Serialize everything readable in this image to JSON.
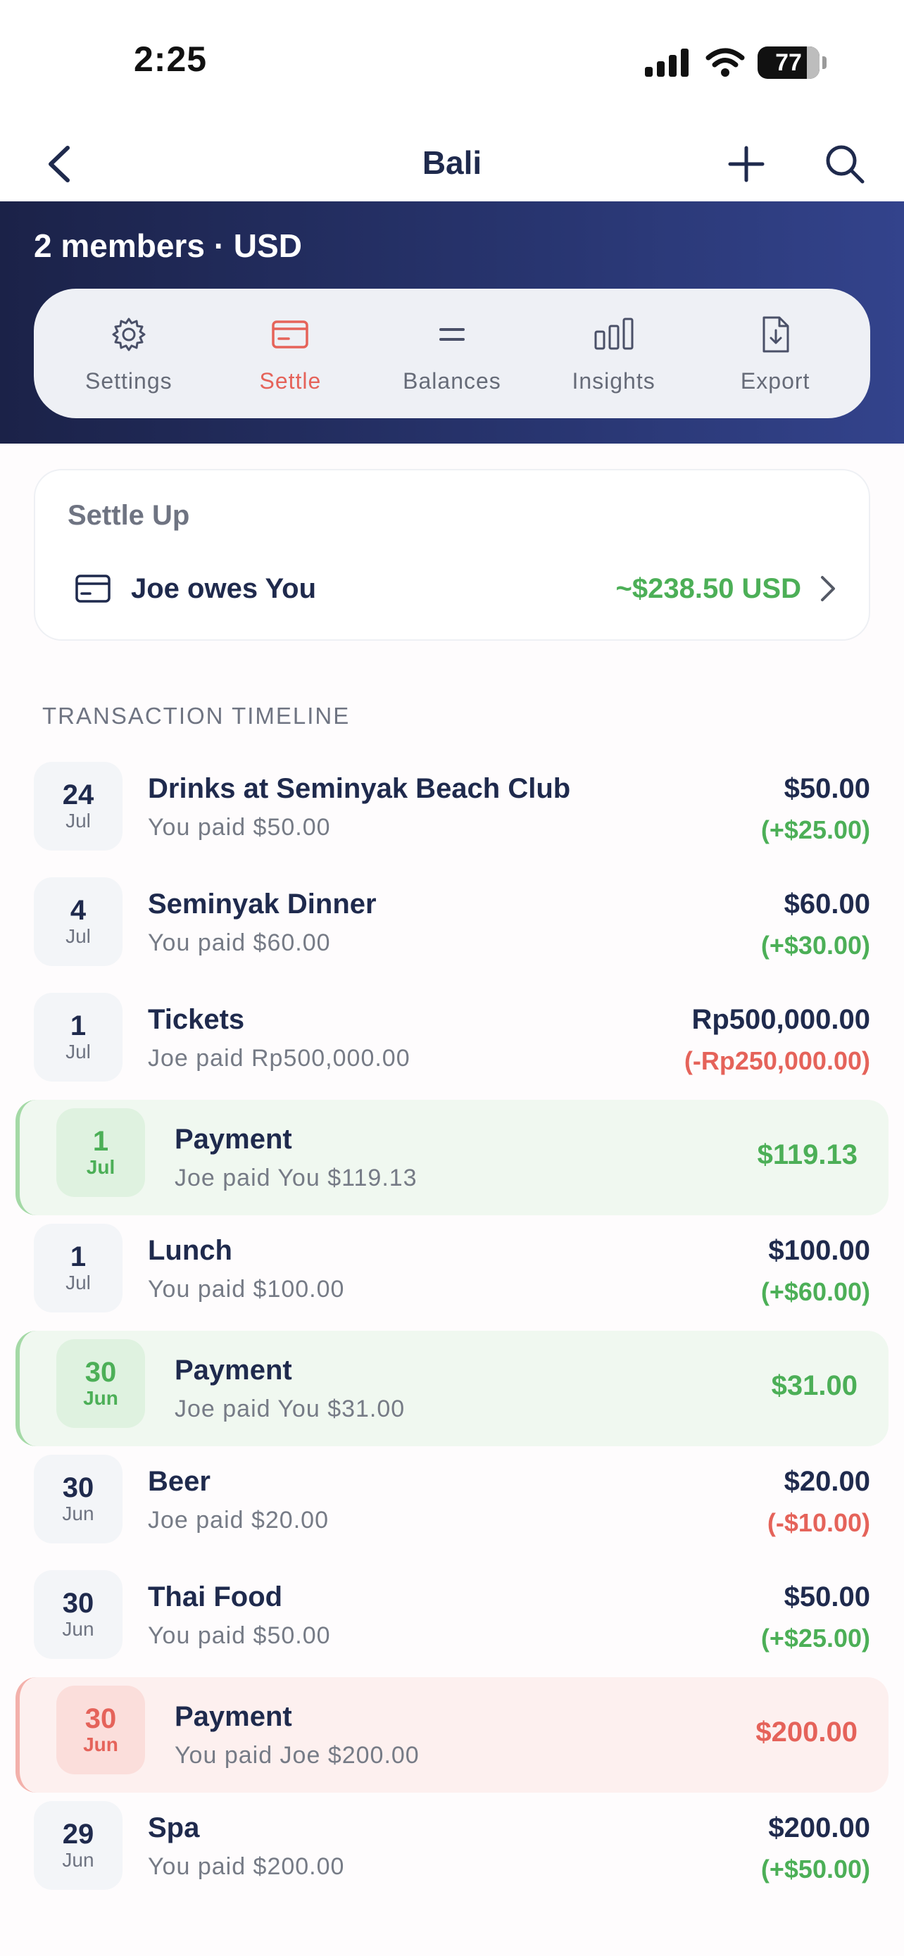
{
  "status_bar": {
    "time": "2:25",
    "battery": "77"
  },
  "nav": {
    "title": "Bali"
  },
  "header": {
    "members_line": "2 members · USD"
  },
  "tabs": [
    {
      "label": "Settings",
      "icon": "gear-icon"
    },
    {
      "label": "Settle",
      "icon": "card-icon"
    },
    {
      "label": "Balances",
      "icon": "equals-icon"
    },
    {
      "label": "Insights",
      "icon": "bar-chart-icon"
    },
    {
      "label": "Export",
      "icon": "file-download-icon"
    }
  ],
  "active_tab": "Settle",
  "settle_up": {
    "title": "Settle Up",
    "text": "Joe owes You",
    "amount": "~$238.50 USD"
  },
  "timeline": {
    "title": "TRANSACTION TIMELINE",
    "items": [
      {
        "kind": "expense",
        "day": "24",
        "month": "Jul",
        "name": "Drinks at Seminyak Beach Club",
        "sub": "You paid $50.00",
        "amount": "$50.00",
        "delta": "(+$25.00)",
        "delta_sign": "pos"
      },
      {
        "kind": "expense",
        "day": "4",
        "month": "Jul",
        "name": "Seminyak Dinner",
        "sub": "You paid $60.00",
        "amount": "$60.00",
        "delta": "(+$30.00)",
        "delta_sign": "pos"
      },
      {
        "kind": "expense",
        "day": "1",
        "month": "Jul",
        "name": "Tickets",
        "sub": "Joe paid Rp500,000.00",
        "amount": "Rp500,000.00",
        "delta": "(-Rp250,000.00)",
        "delta_sign": "neg"
      },
      {
        "kind": "payment-received",
        "day": "1",
        "month": "Jul",
        "name": "Payment",
        "sub": "Joe paid You $119.13",
        "amount": "$119.13",
        "delta": "",
        "delta_sign": ""
      },
      {
        "kind": "expense",
        "day": "1",
        "month": "Jul",
        "name": "Lunch",
        "sub": "You paid $100.00",
        "amount": "$100.00",
        "delta": "(+$60.00)",
        "delta_sign": "pos"
      },
      {
        "kind": "payment-received",
        "day": "30",
        "month": "Jun",
        "name": "Payment",
        "sub": "Joe paid You $31.00",
        "amount": "$31.00",
        "delta": "",
        "delta_sign": ""
      },
      {
        "kind": "expense",
        "day": "30",
        "month": "Jun",
        "name": "Beer",
        "sub": "Joe paid $20.00",
        "amount": "$20.00",
        "delta": "(-$10.00)",
        "delta_sign": "neg"
      },
      {
        "kind": "expense",
        "day": "30",
        "month": "Jun",
        "name": "Thai Food",
        "sub": "You paid $50.00",
        "amount": "$50.00",
        "delta": "(+$25.00)",
        "delta_sign": "pos"
      },
      {
        "kind": "payment-sent",
        "day": "30",
        "month": "Jun",
        "name": "Payment",
        "sub": "You paid Joe $200.00",
        "amount": "$200.00",
        "delta": "",
        "delta_sign": ""
      },
      {
        "kind": "expense",
        "day": "29",
        "month": "Jun",
        "name": "Spa",
        "sub": "You paid $200.00",
        "amount": "$200.00",
        "delta": "(+$50.00)",
        "delta_sign": "pos"
      }
    ]
  },
  "colors": {
    "navy": "#1f2a4d",
    "accent_red": "#e5635a",
    "accent_green": "#4caf57",
    "header_gradient_start": "#1b2248",
    "header_gradient_end": "#33438c"
  }
}
